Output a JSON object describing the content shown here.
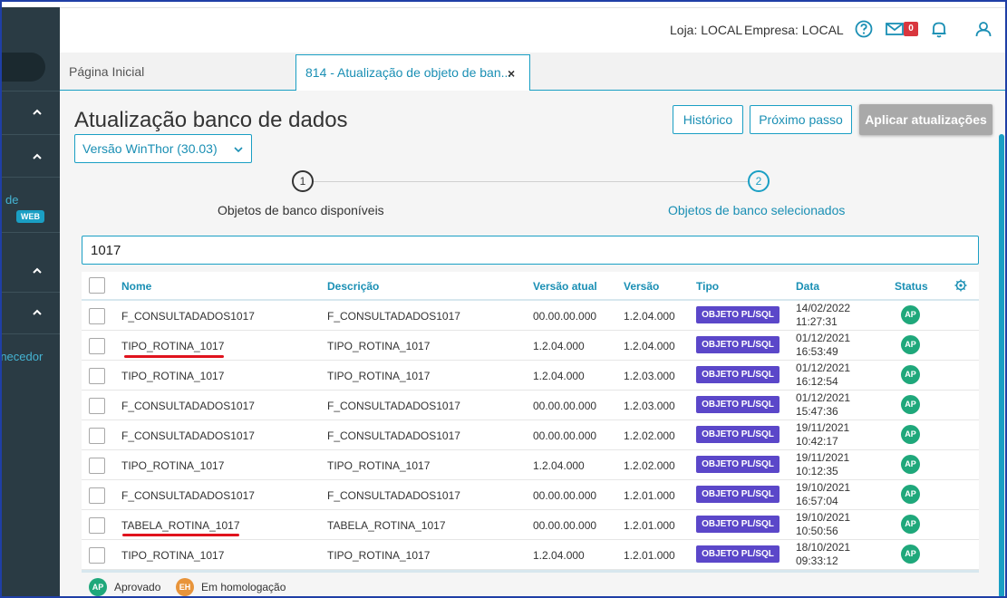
{
  "sidebar": {
    "items": [
      {
        "label": "de"
      },
      {
        "label": "WEB"
      },
      {
        "label": "rnecedor"
      }
    ]
  },
  "header": {
    "loja": "Loja: LOCAL",
    "empresa": "Empresa: LOCAL",
    "mail_count": "0"
  },
  "tabs": {
    "home": "Página Inicial",
    "active": "814 - Atualização de objeto de ban...",
    "close": "×"
  },
  "page": {
    "title": "Atualização banco de dados",
    "version_select": "Versão WinThor (30.03)",
    "buttons": {
      "historico": "Histórico",
      "proximo": "Próximo passo",
      "aplicar": "Aplicar atualizações"
    }
  },
  "stepper": [
    {
      "number": "1",
      "label": "Objetos de banco disponíveis"
    },
    {
      "number": "2",
      "label": "Objetos de banco selecionados"
    }
  ],
  "search": {
    "value": "1017"
  },
  "table": {
    "columns": [
      "Nome",
      "Descrição",
      "Versão atual",
      "Versão",
      "Tipo",
      "Data",
      "Status"
    ],
    "rows": [
      {
        "nome": "F_CONSULTADADOS1017",
        "descricao": "F_CONSULTADADOS1017",
        "versao_atual": "00.00.00.000",
        "versao": "1.2.04.000",
        "tipo": "OBJETO PL/SQL",
        "data": "14/02/2022",
        "hora": "11:27:31",
        "status": "AP"
      },
      {
        "nome": "TIPO_ROTINA_1017",
        "descricao": "TIPO_ROTINA_1017",
        "versao_atual": "1.2.04.000",
        "versao": "1.2.04.000",
        "tipo": "OBJETO PL/SQL",
        "data": "01/12/2021",
        "hora": "16:53:49",
        "status": "AP"
      },
      {
        "nome": "TIPO_ROTINA_1017",
        "descricao": "TIPO_ROTINA_1017",
        "versao_atual": "1.2.04.000",
        "versao": "1.2.03.000",
        "tipo": "OBJETO PL/SQL",
        "data": "01/12/2021",
        "hora": "16:12:54",
        "status": "AP"
      },
      {
        "nome": "F_CONSULTADADOS1017",
        "descricao": "F_CONSULTADADOS1017",
        "versao_atual": "00.00.00.000",
        "versao": "1.2.03.000",
        "tipo": "OBJETO PL/SQL",
        "data": "01/12/2021",
        "hora": "15:47:36",
        "status": "AP"
      },
      {
        "nome": "F_CONSULTADADOS1017",
        "descricao": "F_CONSULTADADOS1017",
        "versao_atual": "00.00.00.000",
        "versao": "1.2.02.000",
        "tipo": "OBJETO PL/SQL",
        "data": "19/11/2021",
        "hora": "10:42:17",
        "status": "AP"
      },
      {
        "nome": "TIPO_ROTINA_1017",
        "descricao": "TIPO_ROTINA_1017",
        "versao_atual": "1.2.04.000",
        "versao": "1.2.02.000",
        "tipo": "OBJETO PL/SQL",
        "data": "19/11/2021",
        "hora": "10:12:35",
        "status": "AP"
      },
      {
        "nome": "F_CONSULTADADOS1017",
        "descricao": "F_CONSULTADADOS1017",
        "versao_atual": "00.00.00.000",
        "versao": "1.2.01.000",
        "tipo": "OBJETO PL/SQL",
        "data": "19/10/2021",
        "hora": "16:57:04",
        "status": "AP"
      },
      {
        "nome": "TABELA_ROTINA_1017",
        "descricao": "TABELA_ROTINA_1017",
        "versao_atual": "00.00.00.000",
        "versao": "1.2.01.000",
        "tipo": "OBJETO PL/SQL",
        "data": "19/10/2021",
        "hora": "10:50:56",
        "status": "AP"
      },
      {
        "nome": "TIPO_ROTINA_1017",
        "descricao": "TIPO_ROTINA_1017",
        "versao_atual": "1.2.04.000",
        "versao": "1.2.01.000",
        "tipo": "OBJETO PL/SQL",
        "data": "18/10/2021",
        "hora": "09:33:12",
        "status": "AP"
      }
    ]
  },
  "legend": [
    {
      "code": "AP",
      "label": "Aprovado",
      "color": "#1fa87b"
    },
    {
      "code": "EH",
      "label": "Em homologação",
      "color": "#e8943a"
    }
  ],
  "colors": {
    "accent": "#1a9fc4",
    "badge_purple": "#5b47c9",
    "status_green": "#1fa87b",
    "highlight_red": "#e0131d"
  }
}
